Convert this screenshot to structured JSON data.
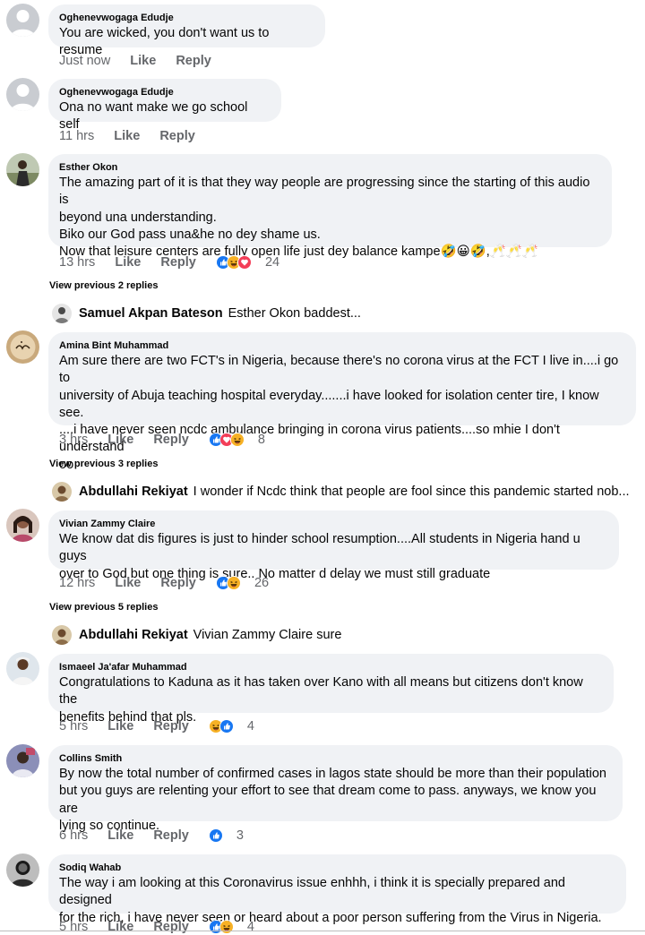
{
  "colors": {
    "bubble": "#f0f2f5",
    "meta": "#65676b",
    "like_blue": "#1877f2",
    "haha_yellow": "#f7b125",
    "love_red": "#f33e58"
  },
  "comments": [
    {
      "author": "Oghenevwogaga Edudje",
      "text": "You are wicked, you don't want us to resume",
      "time": "Just now",
      "like": "Like",
      "reply": "Reply",
      "reactions": [],
      "count": ""
    },
    {
      "author": "Oghenevwogaga Edudje",
      "text": "Ona no want make we go school self",
      "time": "11 hrs",
      "like": "Like",
      "reply": "Reply",
      "reactions": [],
      "count": ""
    },
    {
      "author": "Esther Okon",
      "text": "The amazing part of it is that they way people are progressing since the starting of this audio is\nbeyond una understanding.\nBiko our God pass una&he no dey shame us.\nNow that leisure centers are fully open life just dey balance kampe🤣😀🤣,🥂🥂🥂",
      "time": "13 hrs",
      "like": "Like",
      "reply": "Reply",
      "reactions": [
        "like-icon",
        "haha-icon",
        "love-icon"
      ],
      "count": "24"
    },
    {
      "author": "Amina Bint Muhammad",
      "text": "Am sure there are two FCT's in Nigeria, because there's no corona virus at the FCT I live in....i go to\nuniversity of Abuja teaching hospital everyday.......i have looked for isolation center tire, I know see.\n....i have never seen ncdc ambulance bringing in corona virus patients....so mhie I don't understand\noo",
      "time": "3 hrs",
      "like": "Like",
      "reply": "Reply",
      "reactions": [
        "like-icon",
        "love-icon",
        "haha-icon"
      ],
      "count": "8"
    },
    {
      "author": "Vivian Zammy Claire",
      "text": "We know dat dis figures is just to hinder school resumption....All students in Nigeria hand u guys\nover to God but one thing is sure.. No matter d delay we must still graduate",
      "time": "12 hrs",
      "like": "Like",
      "reply": "Reply",
      "reactions": [
        "like-icon",
        "haha-icon"
      ],
      "count": "26"
    },
    {
      "author": "Ismaeel Ja'afar Muhammad",
      "text": "Congratulations to Kaduna as it has taken over Kano with all means but citizens don't know the\nbenefits behind that pls.",
      "time": "5 hrs",
      "like": "Like",
      "reply": "Reply",
      "reactions": [
        "haha-icon",
        "like-icon"
      ],
      "count": "4"
    },
    {
      "author": "Collins Smith",
      "text": "By now the total number of confirmed cases in lagos state should be more than their population\nbut you guys are relenting your effort to see that dream come to pass. anyways, we know you are\nlying so continue.",
      "time": "6 hrs",
      "like": "Like",
      "reply": "Reply",
      "reactions": [
        "like-icon"
      ],
      "count": "3"
    },
    {
      "author": "Sodiq Wahab",
      "text": "The way i am looking at this Coronavirus issue enhhh, i think it is specially prepared and designed\nfor the rich, i have never seen or heard about a poor person suffering from the Virus in Nigeria.",
      "time": "5 hrs",
      "like": "Like",
      "reply": "Reply",
      "reactions": [
        "like-icon",
        "haha-icon"
      ],
      "count": "4"
    }
  ],
  "threads": [
    {
      "view_previous": "View previous 2 replies",
      "reply_author": "Samuel Akpan Bateson",
      "reply_text": "Esther Okon baddest..."
    },
    {
      "view_previous": "View previous 3 replies",
      "reply_author": "Abdullahi Rekiyat",
      "reply_text": "I wonder if Ncdc think that people are fool since this pandemic started nob..."
    },
    {
      "view_previous": "View previous 5 replies",
      "reply_author": "Abdullahi Rekiyat",
      "reply_text": "Vivian Zammy Claire sure"
    }
  ]
}
